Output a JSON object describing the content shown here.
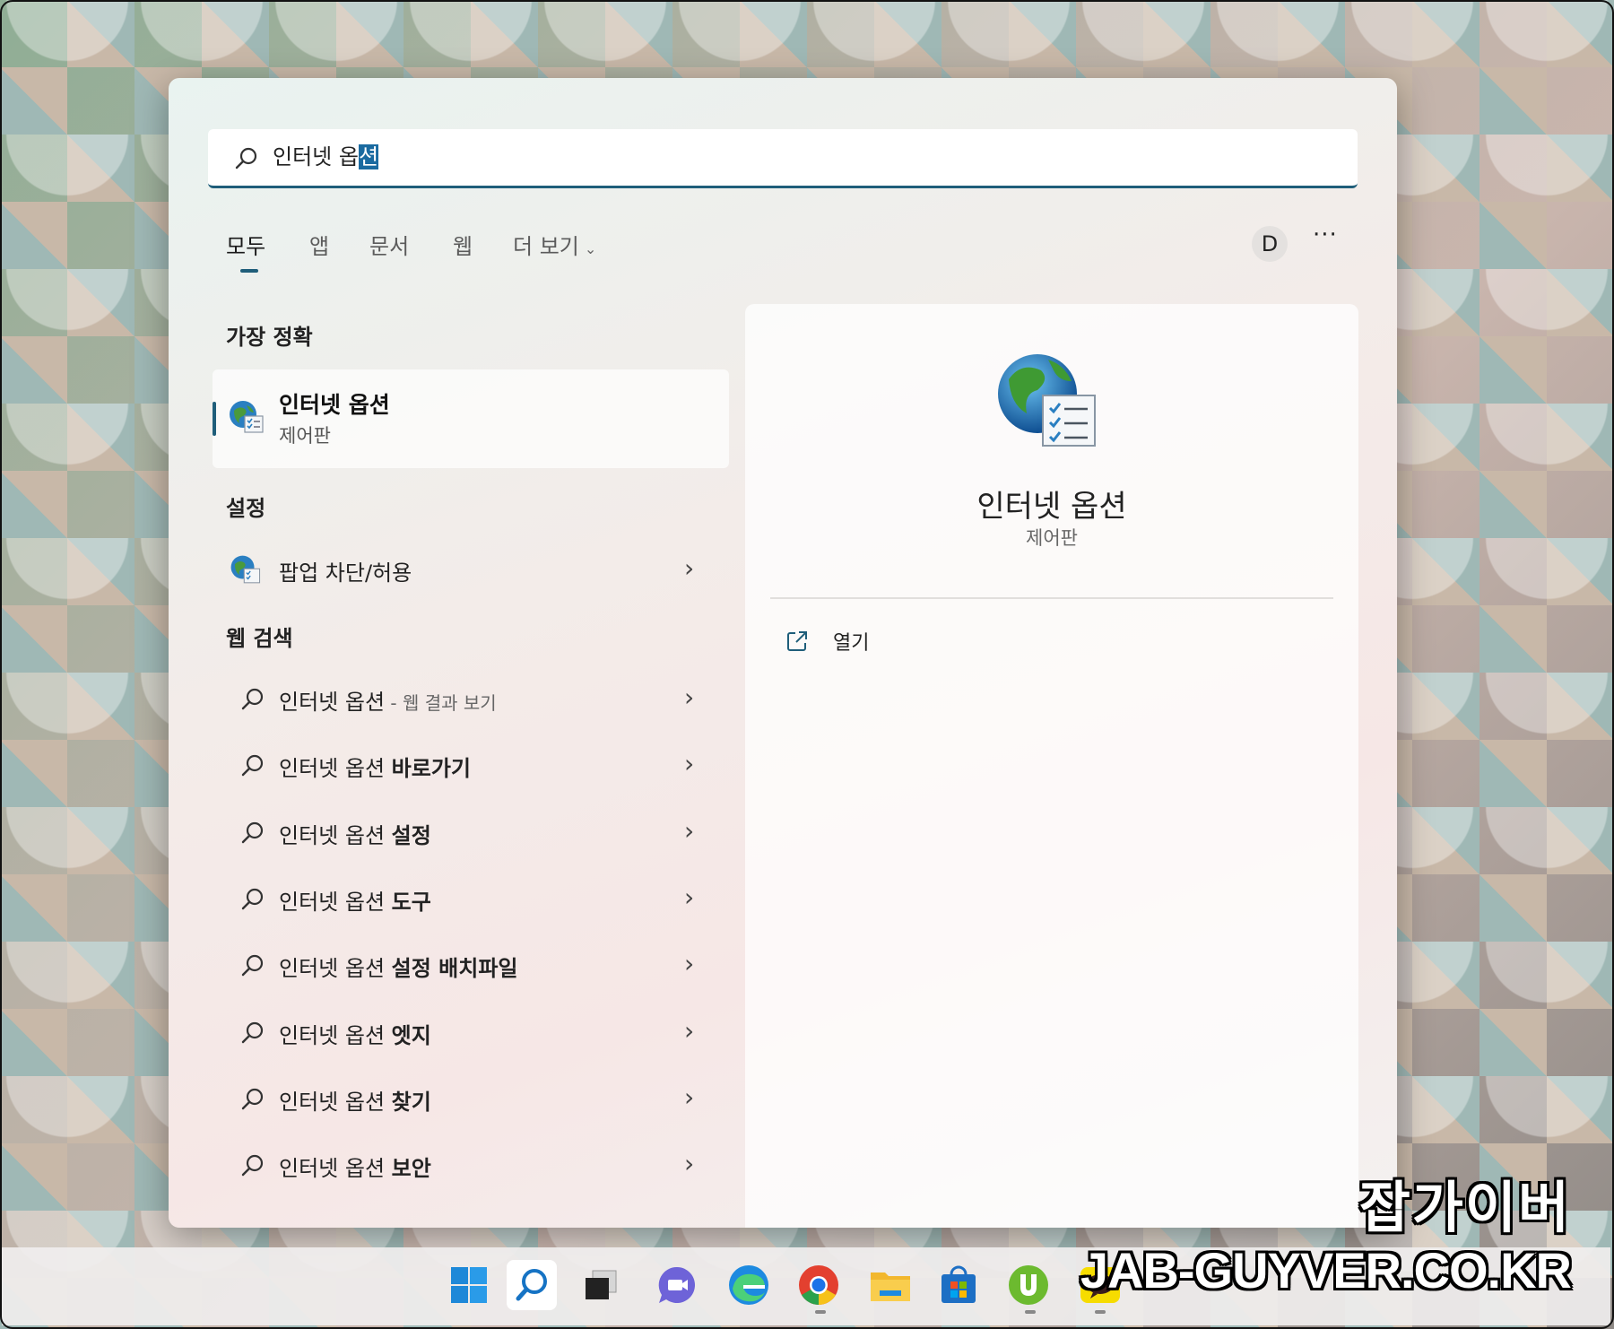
{
  "search": {
    "query_prefix": "인터넷 옵",
    "query_selected": "션"
  },
  "tabs": [
    {
      "label": "모두",
      "active": true
    },
    {
      "label": "앱"
    },
    {
      "label": "문서"
    },
    {
      "label": "웹"
    },
    {
      "label": "더 보기"
    }
  ],
  "header": {
    "avatar_letter": "D",
    "more_label": "···"
  },
  "sections": {
    "best_match": "가장 정확",
    "settings": "설정",
    "web_search": "웹 검색"
  },
  "best_match": {
    "title": "인터넷 옵션",
    "subtitle": "제어판",
    "icon": "internet-options-icon"
  },
  "settings_items": [
    {
      "label": "팝업 차단/허용",
      "icon": "internet-options-icon"
    }
  ],
  "web_results": [
    {
      "base": "인터넷 옵션",
      "suffix": "",
      "hint": " - 웹 결과 보기"
    },
    {
      "base": "인터넷 옵션 ",
      "suffix": "바로가기",
      "hint": ""
    },
    {
      "base": "인터넷 옵션 ",
      "suffix": "설정",
      "hint": ""
    },
    {
      "base": "인터넷 옵션 ",
      "suffix": "도구",
      "hint": ""
    },
    {
      "base": "인터넷 옵션 ",
      "suffix": "설정 배치파일",
      "hint": ""
    },
    {
      "base": "인터넷 옵션 ",
      "suffix": "엣지",
      "hint": ""
    },
    {
      "base": "인터넷 옵션 ",
      "suffix": "찾기",
      "hint": ""
    },
    {
      "base": "인터넷 옵션 ",
      "suffix": "보안",
      "hint": ""
    }
  ],
  "preview": {
    "title": "인터넷 옵션",
    "subtitle": "제어판",
    "actions": [
      {
        "label": "열기",
        "icon": "open-external-icon"
      }
    ]
  },
  "taskbar": {
    "icons": [
      "windows-start-icon",
      "search-icon",
      "task-view-icon",
      "teams-chat-icon",
      "edge-icon",
      "chrome-icon",
      "file-explorer-icon",
      "store-icon",
      "utorrent-icon",
      "kakaotalk-icon"
    ]
  },
  "watermark": {
    "korean": "잡가이버",
    "url": "JAB-GUYVER.CO.KR"
  },
  "colors": {
    "accent": "#1f5e7a",
    "selection": "#1a6aa0"
  }
}
